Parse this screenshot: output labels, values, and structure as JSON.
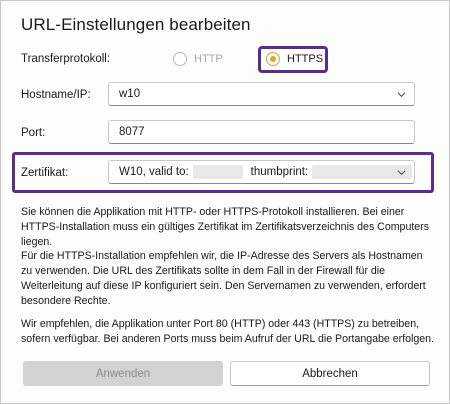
{
  "dialog": {
    "title": "URL-Einstellungen bearbeiten",
    "transfer_protocol_label": "Transferprotokoll:",
    "protocols": [
      {
        "label": "HTTP",
        "selected": false,
        "disabled": true
      },
      {
        "label": "HTTPS",
        "selected": true,
        "disabled": false
      }
    ],
    "hostname_label": "Hostname/IP:",
    "hostname_value": "w10",
    "port_label": "Port:",
    "port_value": "8077",
    "certificate_label": "Zertifikat:",
    "certificate_prefix": "W10, valid to:",
    "certificate_thumbprint_label": "thumbprint:",
    "paragraphs": [
      "Sie können die Applikation mit HTTP- oder HTTPS-Protokoll installieren. Bei einer HTTPS-Installation muss ein gültiges Zertifikat im Zertifikatsverzeichnis des Computers liegen.",
      "Für die HTTPS-Installation empfehlen wir, die IP-Adresse des Servers als Hostnamen zu verwenden. Die URL des Zertifikats sollte in dem Fall in der Firewall für die Weiterleitung auf diese IP konfiguriert sein. Den Servernamen zu verwenden, erfordert besondere Rechte.",
      "Wir empfehlen, die Applikation unter Port 80 (HTTP) oder 443 (HTTPS) zu betreiben, sofern verfügbar. Bei anderen Ports muss beim Aufruf der URL die Portangabe erfolgen."
    ],
    "apply_label": "Anwenden",
    "cancel_label": "Abbrechen"
  },
  "colors": {
    "highlight": "#5b2c8f",
    "radio_accent": "#f0a020"
  },
  "icons": {
    "dropdown": "chevron-down-icon",
    "radio": "radio-icon"
  }
}
